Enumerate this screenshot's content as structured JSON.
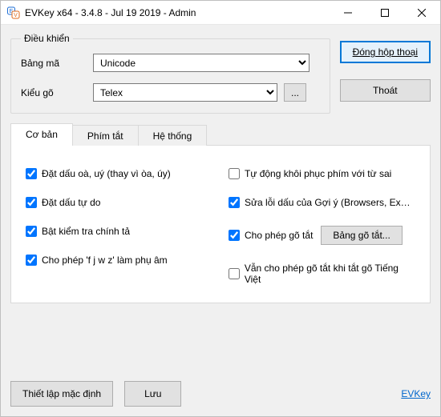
{
  "window": {
    "title": "EVKey x64 - 3.4.8 - Jul 19 2019 - Admin"
  },
  "group": {
    "legend": "Điều khiển",
    "bang_ma_label": "Bảng mã",
    "bang_ma_value": "Unicode",
    "kieu_go_label": "Kiểu gõ",
    "kieu_go_value": "Telex",
    "more_button": "..."
  },
  "actions": {
    "close_dialog": "Đóng hộp thoại",
    "exit": "Thoát"
  },
  "tabs": {
    "basic": "Cơ bản",
    "shortcut": "Phím tắt",
    "system": "Hệ thống"
  },
  "options": {
    "left": [
      {
        "label": "Đặt dấu oà, uý (thay vì òa, úy)",
        "checked": true
      },
      {
        "label": "Đặt dấu tự do",
        "checked": true
      },
      {
        "label": "Bật kiểm tra chính tả",
        "checked": true
      },
      {
        "label": "Cho phép 'f j w z' làm phụ âm",
        "checked": true
      }
    ],
    "right": [
      {
        "label": "Tự động khôi phục phím với từ sai",
        "checked": false
      },
      {
        "label": "Sửa lỗi dấu của Gợi ý (Browsers, Excel ...)",
        "checked": true
      },
      {
        "label": "Cho phép gõ tắt",
        "checked": true,
        "button": "Bảng gõ tắt..."
      },
      {
        "label": "Vẫn cho phép gõ tắt khi tắt gõ Tiếng Việt",
        "checked": false
      }
    ]
  },
  "footer": {
    "defaults": "Thiết lập mặc định",
    "save": "Lưu",
    "link": "EVKey"
  }
}
